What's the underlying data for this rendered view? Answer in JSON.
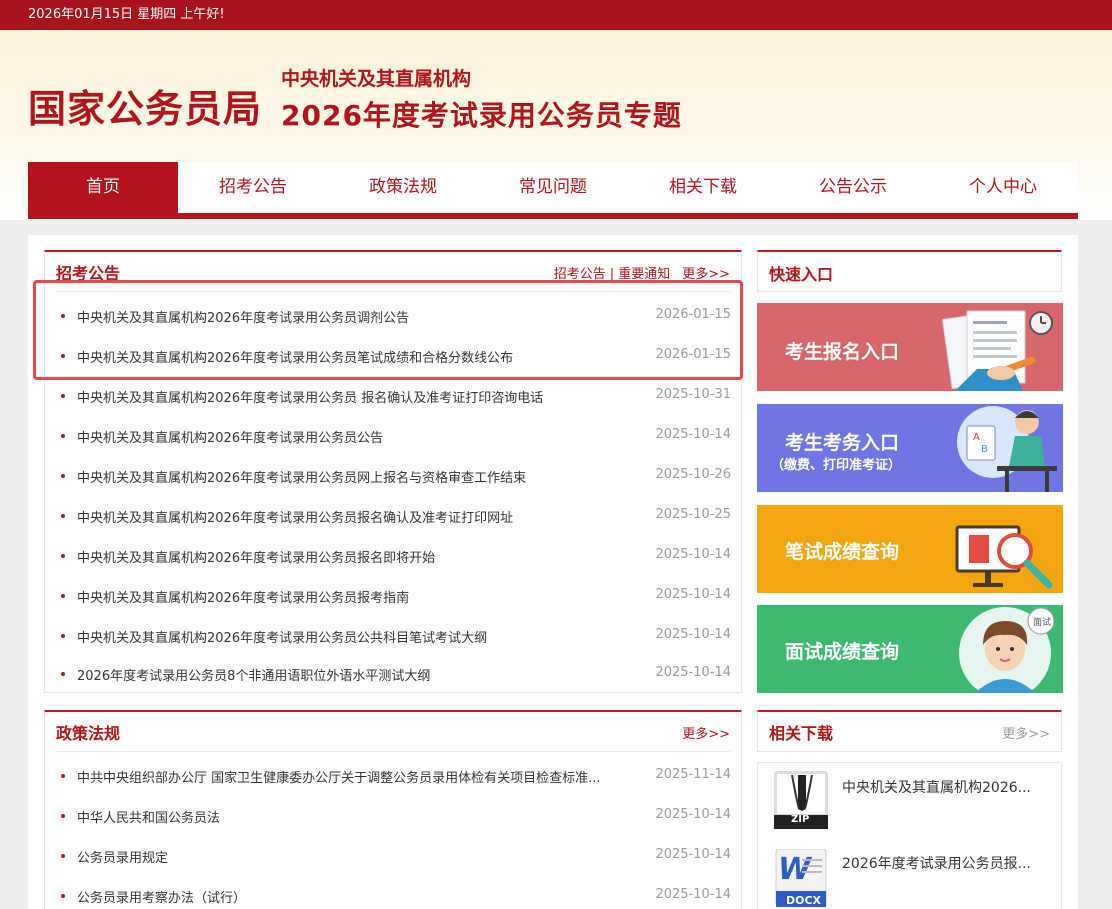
{
  "topbar": {
    "greeting": "2026年01月15日 星期四 上午好!"
  },
  "header": {
    "site_name": "国家公务员局",
    "subtitle1": "中央机关及其直属机构",
    "subtitle2": "2026年度考试录用公务员专题"
  },
  "nav": {
    "items": [
      "首页",
      "招考公告",
      "政策法规",
      "常见问题",
      "相关下载",
      "公告公示",
      "个人中心"
    ],
    "active": "首页"
  },
  "notices": {
    "title": "招考公告",
    "link1": "招考公告",
    "separator": "|",
    "link2": "重要通知",
    "more": "更多>>",
    "items": [
      {
        "title": "中央机关及其直属机构2026年度考试录用公务员调剂公告",
        "date": "2026-01-15"
      },
      {
        "title": "中央机关及其直属机构2026年度考试录用公务员笔试成绩和合格分数线公布",
        "date": "2026-01-15"
      },
      {
        "title": "中央机关及其直属机构2026年度考试录用公务员 报名确认及准考证打印咨询电话",
        "date": "2025-10-31"
      },
      {
        "title": "中央机关及其直属机构2026年度考试录用公务员公告",
        "date": "2025-10-14"
      },
      {
        "title": "中央机关及其直属机构2026年度考试录用公务员网上报名与资格审查工作结束",
        "date": "2025-10-26"
      },
      {
        "title": "中央机关及其直属机构2026年度考试录用公务员报名确认及准考证打印网址",
        "date": "2025-10-25"
      },
      {
        "title": "中央机关及其直属机构2026年度考试录用公务员报名即将开始",
        "date": "2025-10-14"
      },
      {
        "title": "中央机关及其直属机构2026年度考试录用公务员报考指南",
        "date": "2025-10-14"
      },
      {
        "title": "中央机关及其直属机构2026年度考试录用公务员公共科目笔试考试大纲",
        "date": "2025-10-14"
      },
      {
        "title": "2026年度考试录用公务员8个非通用语职位外语水平测试大纲",
        "date": "2025-10-14"
      }
    ]
  },
  "policy": {
    "title": "政策法规",
    "more": "更多>>",
    "items": [
      {
        "title": "中共中央组织部办公厅 国家卫生健康委办公厅关于调整公务员录用体检有关项目检查标准...",
        "date": "2025-11-14"
      },
      {
        "title": "中华人民共和国公务员法",
        "date": "2025-10-14"
      },
      {
        "title": "公务员录用规定",
        "date": "2025-10-14"
      },
      {
        "title": "公务员录用考察办法（试行）",
        "date": "2025-10-14"
      }
    ]
  },
  "quick": {
    "title": "快速入口",
    "banners": [
      {
        "label": "考生报名入口",
        "sub": "",
        "color": "#d9666a",
        "icon": "application-form-icon"
      },
      {
        "label": "考生考务入口",
        "sub": "（缴费、打印准考证）",
        "color": "#7075e6",
        "icon": "student-at-desk-icon"
      },
      {
        "label": "笔试成绩查询",
        "sub": "",
        "color": "#f3a512",
        "icon": "score-board-icon"
      },
      {
        "label": "面试成绩查询",
        "sub": "",
        "color": "#3dba72",
        "icon": "interview-person-icon"
      }
    ]
  },
  "downloads": {
    "title": "相关下载",
    "more": "更多>>",
    "items": [
      {
        "name": "中央机关及其直属机构2026...",
        "type": "ZIP",
        "icon": "zip-file-icon"
      },
      {
        "name": "2026年度考试录用公务员报...",
        "type": "DOCX",
        "icon": "docx-file-icon"
      }
    ]
  },
  "colors": {
    "brand_red": "#b1141b",
    "highlight_box": "#e8464b"
  }
}
